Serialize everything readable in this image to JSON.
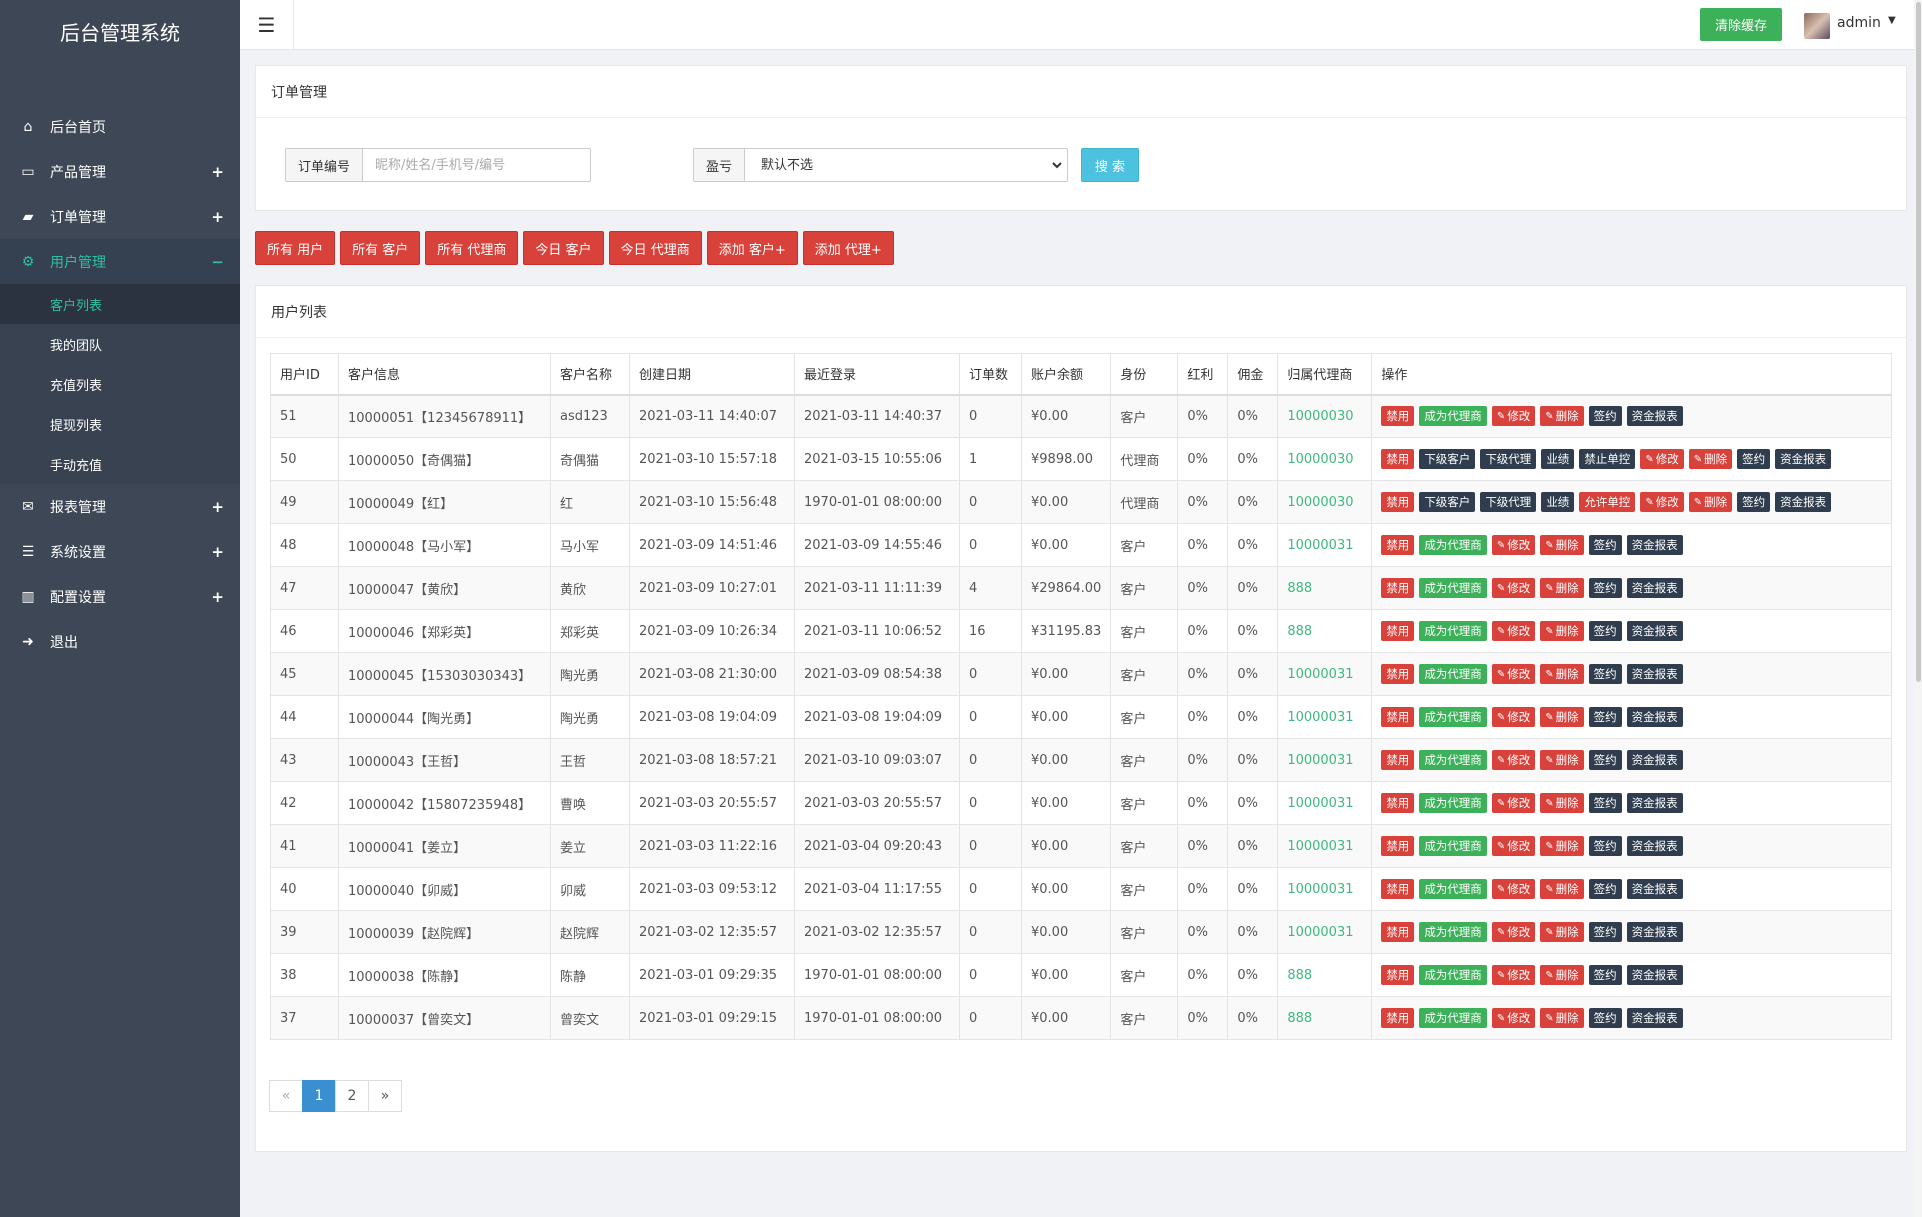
{
  "sidebar": {
    "brand": "后台管理系统",
    "items": [
      {
        "label": "后台首页",
        "icon": "home-icon",
        "glyph": "⌂",
        "sign": ""
      },
      {
        "label": "产品管理",
        "icon": "laptop-icon",
        "glyph": "▭",
        "sign": "+"
      },
      {
        "label": "订单管理",
        "icon": "book-icon",
        "glyph": "▰",
        "sign": "+"
      },
      {
        "label": "用户管理",
        "icon": "cogs-icon",
        "glyph": "⚙",
        "sign": "−"
      },
      {
        "label": "报表管理",
        "icon": "envelope-icon",
        "glyph": "✉",
        "sign": "+"
      },
      {
        "label": "系统设置",
        "icon": "list-icon",
        "glyph": "☰",
        "sign": "+"
      },
      {
        "label": "配置设置",
        "icon": "bar-chart-icon",
        "glyph": "▥",
        "sign": "+"
      },
      {
        "label": "退出",
        "icon": "sign-out-icon",
        "glyph": "➜",
        "sign": ""
      }
    ],
    "sub_items": [
      "客户列表",
      "我的团队",
      "充值列表",
      "提现列表",
      "手动充值"
    ]
  },
  "topbar": {
    "clear_cache": "清除缓存",
    "user": "admin",
    "menu_icon": "bars-icon"
  },
  "filter": {
    "title": "订单管理",
    "order_label": "订单编号",
    "order_placeholder": "昵称/姓名/手机号/编号",
    "profit_label": "盈亏",
    "profit_selected": "默认不选",
    "search": "搜 索"
  },
  "actions": [
    "所有 用户",
    "所有 客户",
    "所有 代理商",
    "今日 客户",
    "今日 代理商",
    "添加 客户+",
    "添加 代理+"
  ],
  "list": {
    "title": "用户列表",
    "headers": [
      "用户ID",
      "客户信息",
      "客户名称",
      "创建日期",
      "最近登录",
      "订单数",
      "账户余额",
      "身份",
      "红利",
      "佣金",
      "归属代理商",
      "操作"
    ],
    "rows": [
      [
        "51",
        "10000051【12345678911】",
        "asd123",
        "2021-03-11 14:40:07",
        "2021-03-11 14:40:37",
        "0",
        "¥0.00",
        "客户",
        "0%",
        "0%",
        "10000030"
      ],
      [
        "50",
        "10000050【奇偶猫】",
        "奇偶猫",
        "2021-03-10 15:57:18",
        "2021-03-15 10:55:06",
        "1",
        "¥9898.00",
        "代理商",
        "0%",
        "0%",
        "10000030"
      ],
      [
        "49",
        "10000049【红】",
        "红",
        "2021-03-10 15:56:48",
        "1970-01-01 08:00:00",
        "0",
        "¥0.00",
        "代理商",
        "0%",
        "0%",
        "10000030"
      ],
      [
        "48",
        "10000048【马小军】",
        "马小军",
        "2021-03-09 14:51:46",
        "2021-03-09 14:55:46",
        "0",
        "¥0.00",
        "客户",
        "0%",
        "0%",
        "10000031"
      ],
      [
        "47",
        "10000047【黄欣】",
        "黄欣",
        "2021-03-09 10:27:01",
        "2021-03-11 11:11:39",
        "4",
        "¥29864.00",
        "客户",
        "0%",
        "0%",
        "888"
      ],
      [
        "46",
        "10000046【郑彩英】",
        "郑彩英",
        "2021-03-09 10:26:34",
        "2021-03-11 10:06:52",
        "16",
        "¥31195.83",
        "客户",
        "0%",
        "0%",
        "888"
      ],
      [
        "45",
        "10000045【15303030343】",
        "陶光勇",
        "2021-03-08 21:30:00",
        "2021-03-09 08:54:38",
        "0",
        "¥0.00",
        "客户",
        "0%",
        "0%",
        "10000031"
      ],
      [
        "44",
        "10000044【陶光勇】",
        "陶光勇",
        "2021-03-08 19:04:09",
        "2021-03-08 19:04:09",
        "0",
        "¥0.00",
        "客户",
        "0%",
        "0%",
        "10000031"
      ],
      [
        "43",
        "10000043【王哲】",
        "王哲",
        "2021-03-08 18:57:21",
        "2021-03-10 09:03:07",
        "0",
        "¥0.00",
        "客户",
        "0%",
        "0%",
        "10000031"
      ],
      [
        "42",
        "10000042【15807235948】",
        "曹唤",
        "2021-03-03 20:55:57",
        "2021-03-03 20:55:57",
        "0",
        "¥0.00",
        "客户",
        "0%",
        "0%",
        "10000031"
      ],
      [
        "41",
        "10000041【姜立】",
        "姜立",
        "2021-03-03 11:22:16",
        "2021-03-04 09:20:43",
        "0",
        "¥0.00",
        "客户",
        "0%",
        "0%",
        "10000031"
      ],
      [
        "40",
        "10000040【卯威】",
        "卯威",
        "2021-03-03 09:53:12",
        "2021-03-04 11:17:55",
        "0",
        "¥0.00",
        "客户",
        "0%",
        "0%",
        "10000031"
      ],
      [
        "39",
        "10000039【赵院辉】",
        "赵院辉",
        "2021-03-02 12:35:57",
        "2021-03-02 12:35:57",
        "0",
        "¥0.00",
        "客户",
        "0%",
        "0%",
        "10000031"
      ],
      [
        "38",
        "10000038【陈静】",
        "陈静",
        "2021-03-01 09:29:35",
        "1970-01-01 08:00:00",
        "0",
        "¥0.00",
        "客户",
        "0%",
        "0%",
        "888"
      ],
      [
        "37",
        "10000037【曾奕文】",
        "曾奕文",
        "2021-03-01 09:29:15",
        "1970-01-01 08:00:00",
        "0",
        "¥0.00",
        "客户",
        "0%",
        "0%",
        "888"
      ]
    ],
    "ops_customer": [
      "禁用",
      "成为代理商",
      "修改",
      "删除",
      "签约",
      "资金报表"
    ],
    "ops_agent_50": [
      "禁用",
      "下级客户",
      "下级代理",
      "业绩",
      "禁止单控",
      "修改",
      "删除",
      "签约",
      "资金报表"
    ],
    "ops_agent_49": [
      "禁用",
      "下级客户",
      "下级代理",
      "业绩",
      "允许单控",
      "修改",
      "删除",
      "签约",
      "资金报表"
    ]
  },
  "pagination": {
    "prev": "«",
    "pages": [
      "1",
      "2"
    ],
    "next": "»",
    "current": "1"
  },
  "colors": {
    "sidebar": "#3e4755",
    "accent": "#2ec0a0",
    "danger": "#d9413b",
    "success": "#3db05a",
    "info": "#4cc2de",
    "dark": "#2f3d4e"
  }
}
